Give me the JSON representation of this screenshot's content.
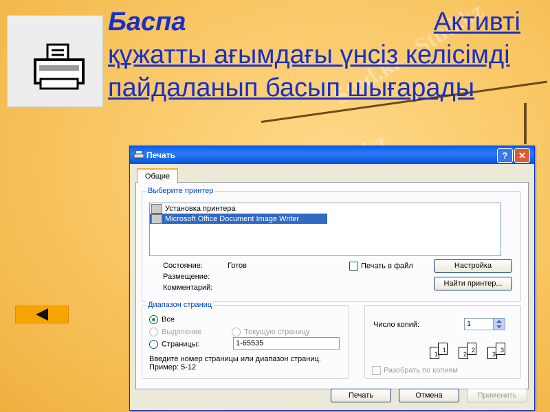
{
  "slide": {
    "title_bold": "Баспа",
    "title_link_first": "Активті",
    "title_link_rest": "құжатты ағымдағы үнсіз келісімді пайдаланып басып шығарады",
    "watermark": "Stud.kz - Stud.kz",
    "accent_color": "#1a2fc8",
    "back_button_icon": "left-triangle-icon",
    "printer_icon": "printer-icon"
  },
  "dialog": {
    "title": "Печать",
    "help_label": "?",
    "close_label": "✕",
    "tab_general": "Общие",
    "printer_group": {
      "label": "Выберите принтер",
      "printers": [
        {
          "name": "Установка принтера",
          "selected": false
        },
        {
          "name": "Microsoft Office Document Image Writer",
          "selected": true
        }
      ],
      "status_label": "Состояние:",
      "status_value": "Готов",
      "location_label": "Размещение:",
      "comment_label": "Комментарий:",
      "print_to_file_label": "Печать в файл",
      "settings_button": "Настройка",
      "find_printer_button": "Найти принтер..."
    },
    "range_group": {
      "label": "Диапазон страниц",
      "all_label": "Все",
      "selection_label": "Выделение",
      "current_page_label": "Текущую страницу",
      "pages_label": "Страницы:",
      "pages_value": "1-65535",
      "hint": "Введите номер страницы или диапазон страниц.  Пример: 5-12"
    },
    "copies": {
      "label": "Число копий:",
      "value": "1",
      "collate_label": "Разобрать по копиям"
    },
    "buttons": {
      "print": "Печать",
      "cancel": "Отмена",
      "apply": "Применить"
    }
  }
}
